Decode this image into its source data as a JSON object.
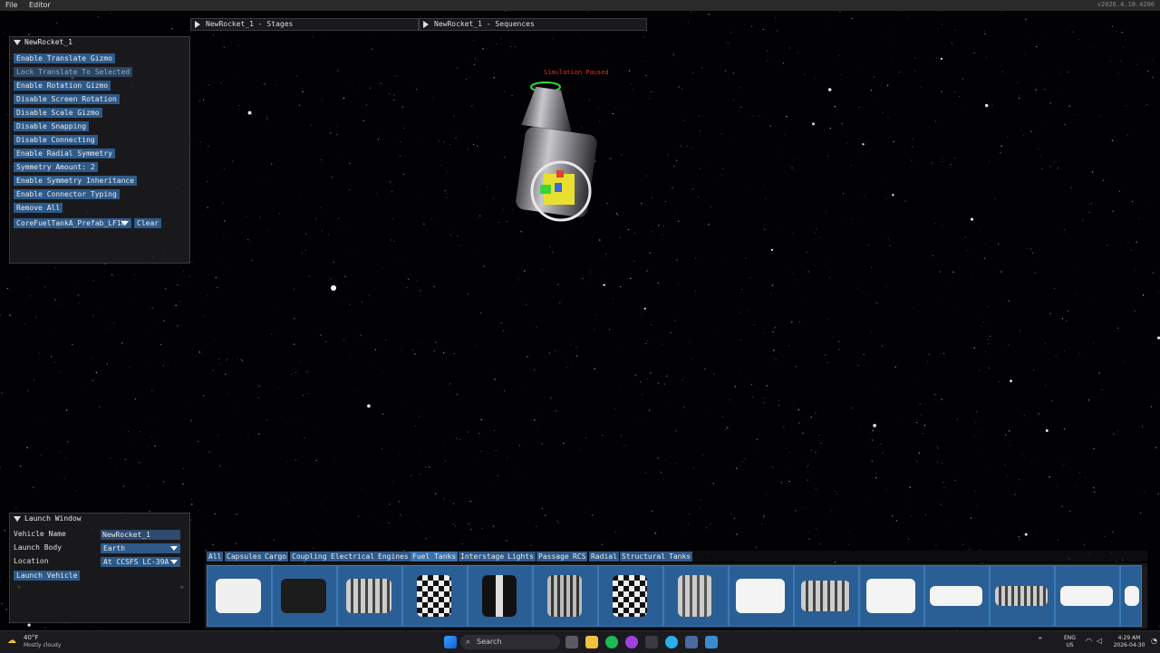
{
  "menubar": {
    "file": "File",
    "editor": "Editor",
    "version": "v2026.4.18.4206"
  },
  "vehicle_panel": {
    "title": "NewRocket_1",
    "buttons": [
      "Enable Translate Gizmo",
      "Lock Translate To Selected",
      "Enable Rotation Gizmo",
      "Disable Screen Rotation",
      "Disable Scale Gizmo",
      "Disable Snapping",
      "Disable Connecting",
      "Enable Radial Symmetry",
      "Symmetry Amount: 2",
      "Enable Symmetry Inheritance",
      "Enable Connector Typing",
      "Remove All"
    ],
    "part_select": "CoreFuelTankA_Prefab_LF1W",
    "clear": "Clear"
  },
  "stages_tab": "NewRocket_1 - Stages",
  "sequences_tab": "NewRocket_1 - Sequences",
  "viewport": {
    "status": "Simulation Paused",
    "status_color": "#e0301e"
  },
  "launch_window": {
    "title": "Launch Window",
    "vehicle_name_label": "Vehicle Name",
    "vehicle_name": "NewRocket_1",
    "launch_body_label": "Launch Body",
    "launch_body": "Earth",
    "location_label": "Location",
    "location": "At CCSFS LC-39A",
    "launch_button": "Launch Vehicle"
  },
  "categories": [
    "All",
    "Capsules",
    "Cargo",
    "Coupling",
    "Electrical",
    "Engines",
    "Fuel Tanks",
    "Interstage",
    "Lights",
    "Passage",
    "RCS",
    "Radial",
    "Structural",
    "Tanks"
  ],
  "active_category": "Fuel Tanks",
  "taskbar": {
    "temperature": "40°F",
    "weather": "Mostly cloudy",
    "search": "Search",
    "lang1": "ENG",
    "lang2": "US",
    "time": "4:29 AM",
    "date": "2026-04-30"
  }
}
